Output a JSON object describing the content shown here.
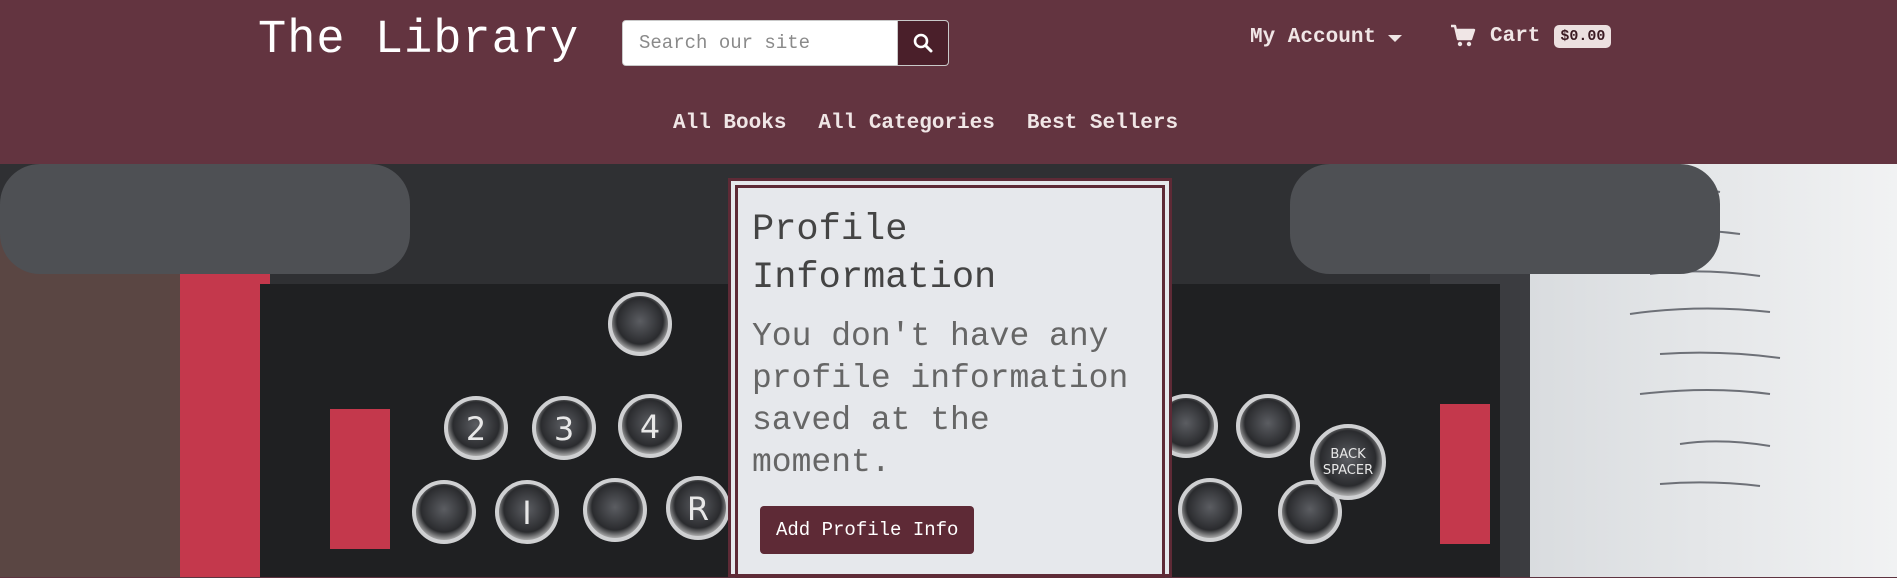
{
  "header": {
    "brand": "The Library",
    "search": {
      "placeholder": "Search our site"
    },
    "account_label": "My Account",
    "cart_label": "Cart",
    "cart_total": "$0.00"
  },
  "subnav": {
    "items": [
      "All Books",
      "All Categories",
      "Best Sellers"
    ]
  },
  "profile_card": {
    "title": "Profile Information",
    "message": "You don't have any profile information saved at the moment.",
    "button_label": "Add Profile Info"
  },
  "colors": {
    "brand_maroon": "#633440",
    "button_maroon": "#5e2a36",
    "card_bg": "#e6e8ec"
  }
}
